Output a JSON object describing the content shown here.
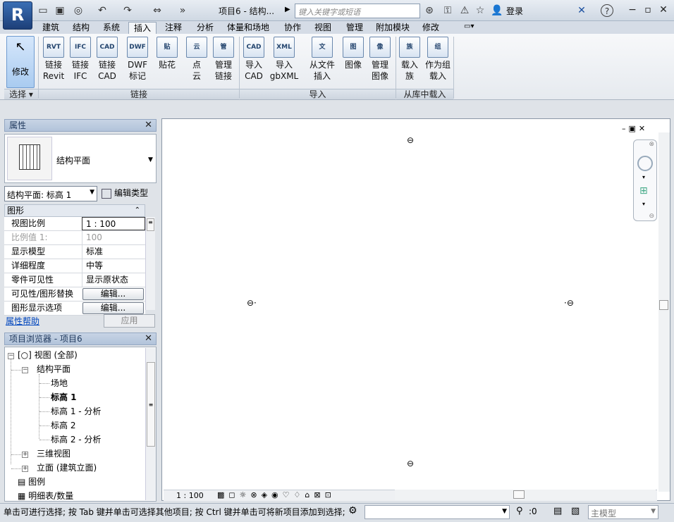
{
  "titlebar": {
    "logo": "R",
    "title": "项目6 - 结构...",
    "search_placeholder": "键入关键字或短语",
    "login": "登录",
    "help": "?"
  },
  "tabs": [
    "建筑",
    "结构",
    "系统",
    "插入",
    "注释",
    "分析",
    "体量和场地",
    "协作",
    "视图",
    "管理",
    "附加模块",
    "修改"
  ],
  "active_tab": "插入",
  "ribbon": {
    "modify": "修改",
    "select_label": "选择",
    "buttons": [
      {
        "line1": "链接",
        "line2": "Revit",
        "icon": "RVT"
      },
      {
        "line1": "链接",
        "line2": "IFC",
        "icon": "IFC"
      },
      {
        "line1": "链接",
        "line2": "CAD",
        "icon": "CAD"
      },
      {
        "line1": "DWF",
        "line2": "标记",
        "icon": "DWF"
      },
      {
        "line1": "贴花",
        "line2": "",
        "icon": "贴"
      },
      {
        "line1": "点",
        "line2": "云",
        "icon": "云"
      },
      {
        "line1": "管理",
        "line2": "链接",
        "icon": "管"
      },
      {
        "line1": "导入",
        "line2": "CAD",
        "icon": "CAD"
      },
      {
        "line1": "导入",
        "line2": "gbXML",
        "icon": "XML"
      },
      {
        "line1": "从文件",
        "line2": "插入",
        "icon": "文"
      },
      {
        "line1": "图像",
        "line2": "",
        "icon": "图"
      },
      {
        "line1": "管理",
        "line2": "图像",
        "icon": "像"
      },
      {
        "line1": "载入",
        "line2": "族",
        "icon": "族"
      },
      {
        "line1": "作为组",
        "line2": "载入",
        "icon": "组"
      }
    ],
    "panels": {
      "link": "链接",
      "import": "导入",
      "library": "从库中载入"
    }
  },
  "properties": {
    "title": "属性",
    "type_name": "结构平面",
    "selector": "结构平面: 标高 1",
    "edit_type": "编辑类型",
    "group": "图形",
    "rows": [
      {
        "k": "视图比例",
        "v": "1 : 100"
      },
      {
        "k": "比例值 1:",
        "v": "100"
      },
      {
        "k": "显示模型",
        "v": "标准"
      },
      {
        "k": "详细程度",
        "v": "中等"
      },
      {
        "k": "零件可见性",
        "v": "显示原状态"
      },
      {
        "k": "可见性/图形替换",
        "v": "编辑..."
      },
      {
        "k": "图形显示选项",
        "v": "编辑..."
      }
    ],
    "help": "属性帮助",
    "apply": "应用"
  },
  "browser": {
    "title": "项目浏览器 - 项目6",
    "views": "视图 (全部)",
    "struct_plans": "结构平面",
    "items": [
      "场地",
      "标高 1",
      "标高 1 - 分析",
      "标高 2",
      "标高 2 - 分析"
    ],
    "three_d": "三维视图",
    "elevations": "立面 (建筑立面)",
    "legend": "图例",
    "schedules": "明细表/数量"
  },
  "viewctrl": {
    "scale": "1 : 100"
  },
  "status": {
    "text": "单击可进行选择; 按 Tab 键并单击可选择其他项目; 按 Ctrl 键并单击可将新项目添加到选择;",
    "zero": ":0",
    "main_model": "主模型"
  },
  "colors": {
    "accent": "#3a6fb5",
    "canvas": "#ffffff"
  }
}
